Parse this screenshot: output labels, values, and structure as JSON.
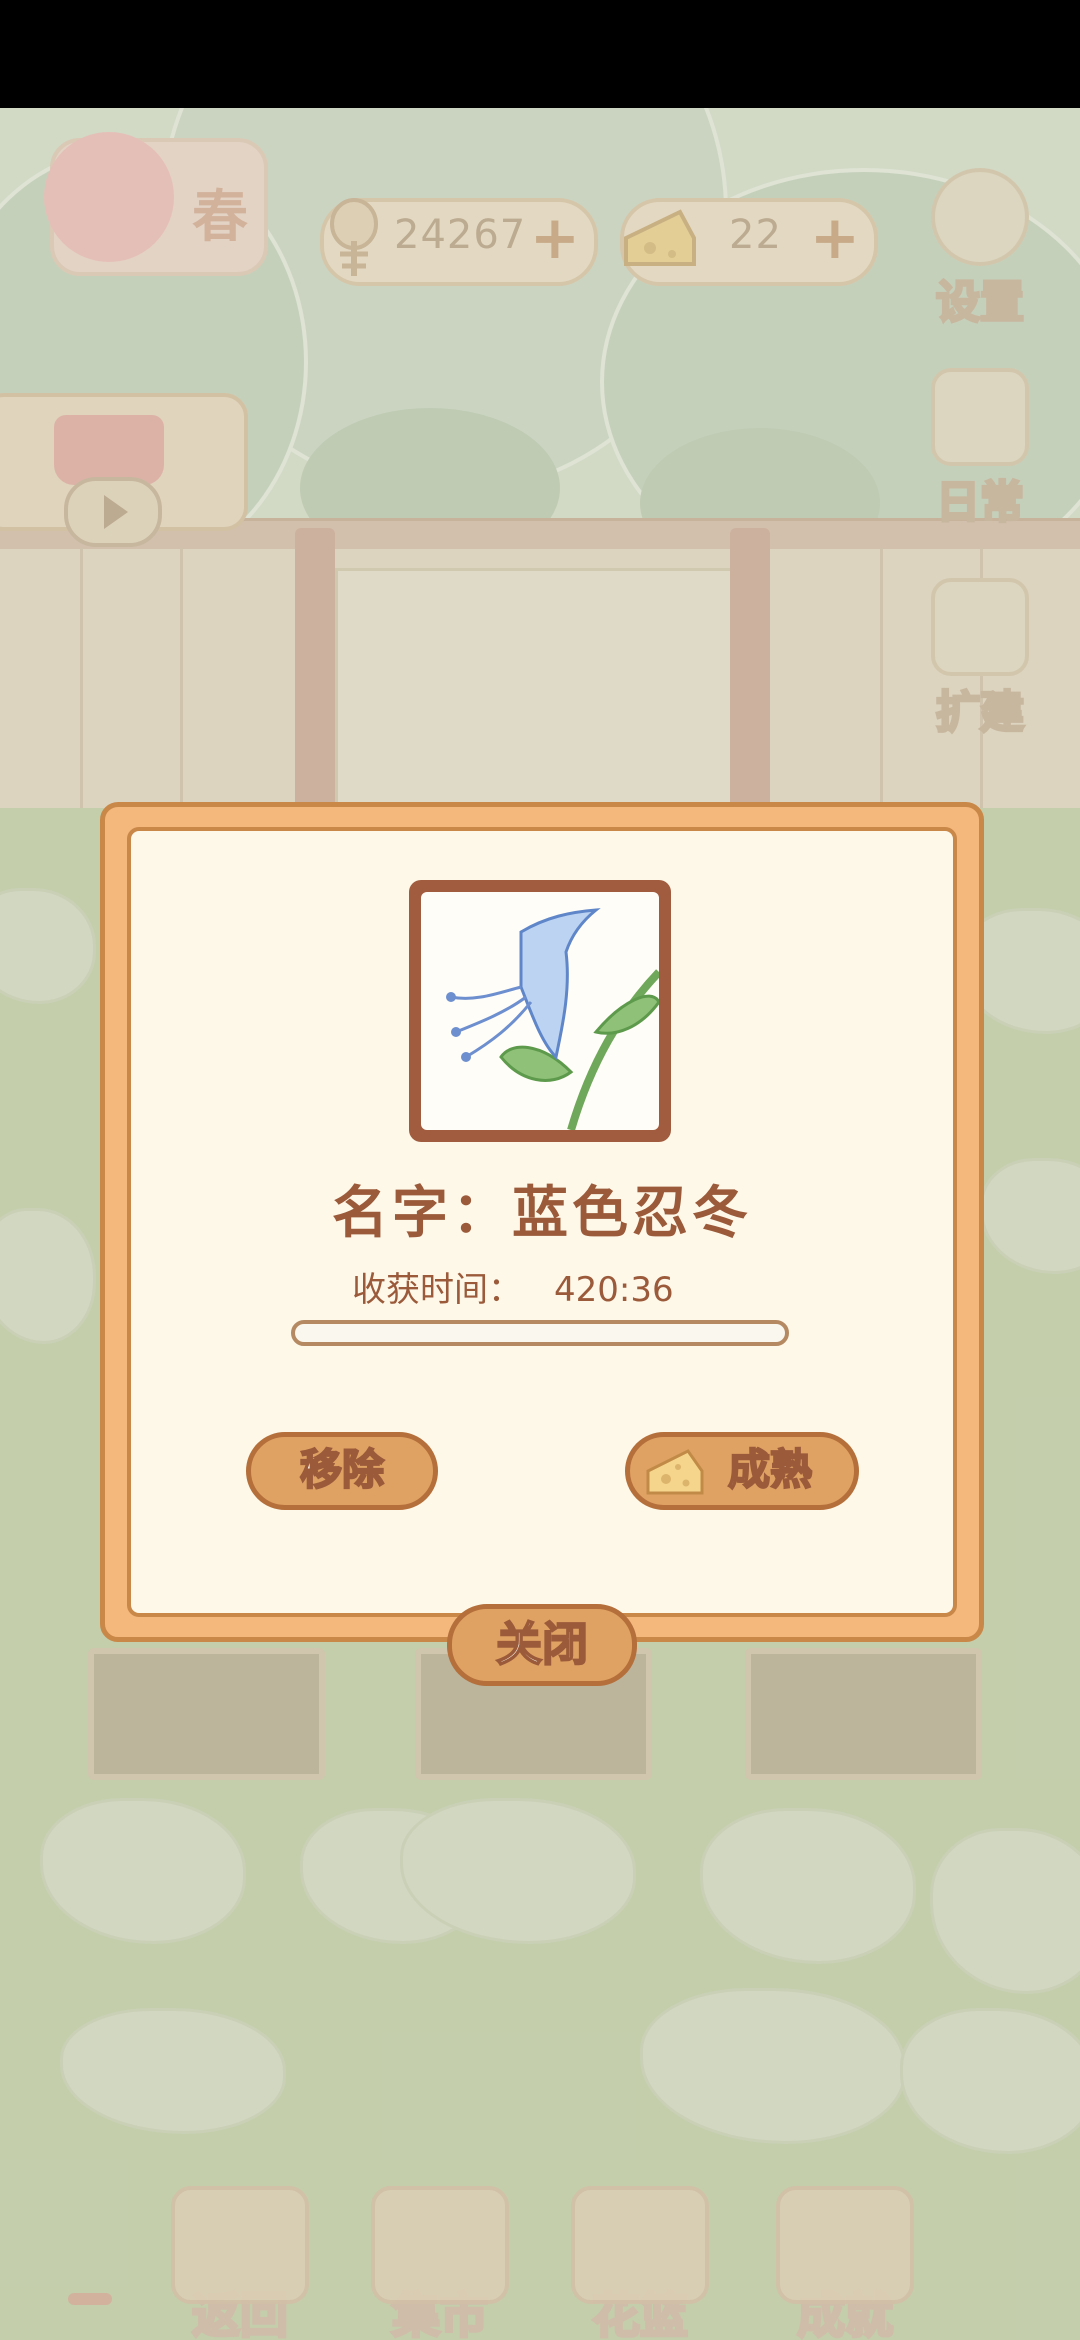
{
  "hud": {
    "season": "春",
    "fish_count": "24267",
    "cheese_count": "22",
    "settings_label": "设置",
    "daily_label": "日常",
    "expand_label": "扩建"
  },
  "modal": {
    "name_label": "名字：",
    "name_value": "蓝色忍冬",
    "harvest_label": "收获时间：",
    "harvest_time": "420:36",
    "progress": 0.0,
    "remove_label": "移除",
    "ripen_label": "成熟",
    "close_label": "关闭"
  },
  "bottom_nav": {
    "items": [
      {
        "label": "返回",
        "icon": "gate-icon"
      },
      {
        "label": "集市",
        "icon": "market-stall-icon"
      },
      {
        "label": "花篮",
        "icon": "flower-basket-icon"
      },
      {
        "label": "成就",
        "icon": "trophy-icon"
      }
    ]
  },
  "colors": {
    "modal_frame": "#f4b77c",
    "modal_body": "#fef8e9",
    "accent_brown": "#9b5a3a",
    "button": "#e0a263"
  }
}
